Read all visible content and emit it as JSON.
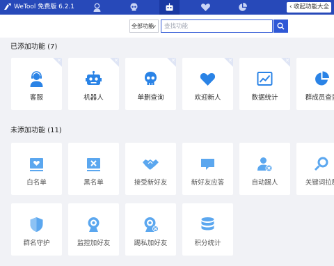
{
  "app": {
    "title": "WeTool 免费版 6.2.1"
  },
  "titlebar": {
    "nav": [
      {
        "icon": "support-agent-icon"
      },
      {
        "icon": "skull-icon"
      },
      {
        "icon": "robot-icon"
      },
      {
        "icon": "heart-icon"
      },
      {
        "icon": "pie-chart-icon"
      }
    ],
    "collapse_label": "收起功能大全"
  },
  "search": {
    "category_value": "全部功能",
    "placeholder": "查找功能"
  },
  "added": {
    "title": "已添加功能 (7)",
    "items": [
      {
        "label": "客服",
        "icon": "support-agent-icon"
      },
      {
        "label": "机器人",
        "icon": "robot-icon"
      },
      {
        "label": "单删查询",
        "icon": "skull-icon"
      },
      {
        "label": "欢迎新人",
        "icon": "heart-icon"
      },
      {
        "label": "数据统计",
        "icon": "line-chart-icon"
      },
      {
        "label": "群成员查重",
        "icon": "pie-chart-icon"
      }
    ]
  },
  "not_added": {
    "title": "未添加功能 (11)",
    "items": [
      {
        "label": "白名单",
        "icon": "whitelist-icon"
      },
      {
        "label": "黑名单",
        "icon": "blacklist-icon"
      },
      {
        "label": "接受新好友",
        "icon": "handshake-icon"
      },
      {
        "label": "新好友应答",
        "icon": "chat-bubble-icon"
      },
      {
        "label": "自动踢人",
        "icon": "kick-user-icon"
      },
      {
        "label": "关键词拉群",
        "icon": "keyword-search-icon"
      },
      {
        "label": "群名守护",
        "icon": "shield-icon"
      },
      {
        "label": "监控加好友",
        "icon": "webcam-icon"
      },
      {
        "label": "踢私加好友",
        "icon": "webcam-kick-icon"
      },
      {
        "label": "积分统计",
        "icon": "database-icon"
      }
    ]
  },
  "colors": {
    "titlebar": "#2749b9",
    "accent": "#2f58d6",
    "active_icon": "#2a83e6",
    "inactive_icon": "#5ba7ef"
  }
}
